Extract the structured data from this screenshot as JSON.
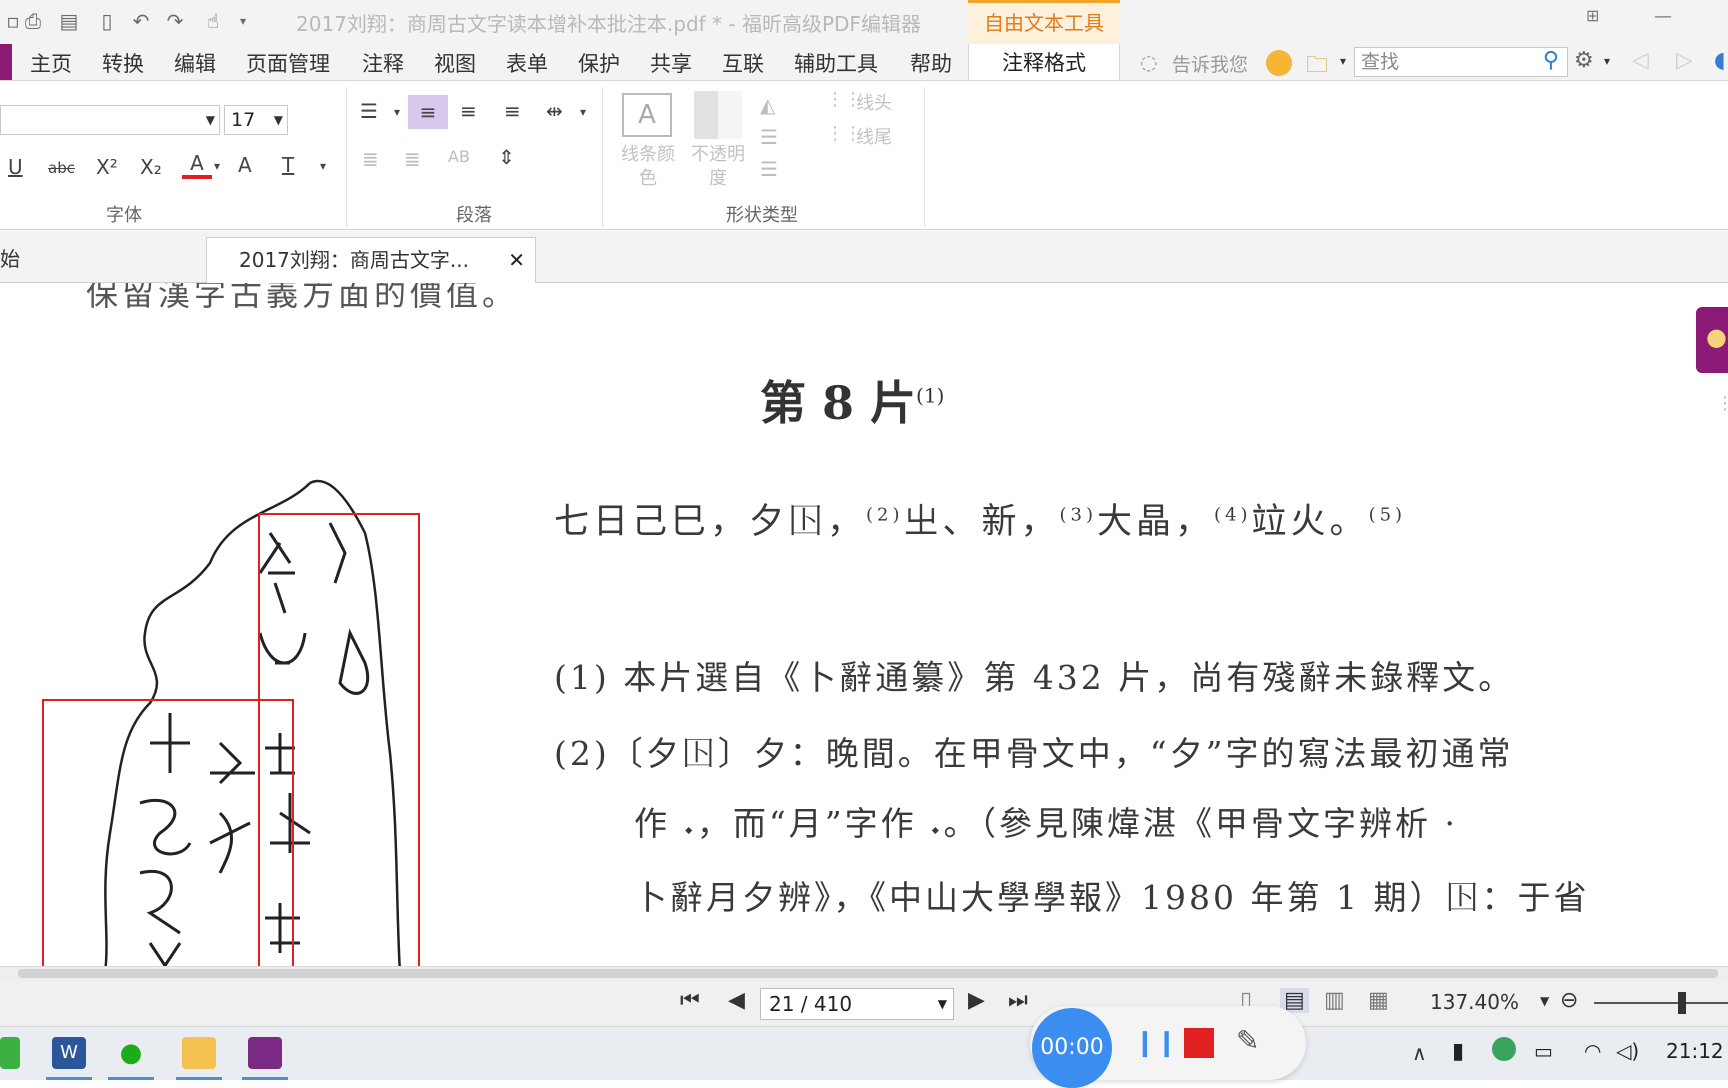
{
  "window": {
    "title": "2017刘翔：商周古文字读本增补本批注本.pdf * - 福昕高级PDF编辑器",
    "context_tab": "自由文本工具"
  },
  "menu": {
    "items": [
      "主页",
      "转换",
      "编辑",
      "页面管理",
      "注释",
      "视图",
      "表单",
      "保护",
      "共享",
      "互联",
      "辅助工具",
      "帮助"
    ],
    "active_tab": "注释格式",
    "tell_me": "告诉我您",
    "search_placeholder": "查找"
  },
  "ribbon": {
    "font_size": "17",
    "font_group_label": "字体",
    "paragraph_group_label": "段落",
    "shape_group_label": "形状类型",
    "line_color_label": "线条颜色",
    "opacity_label": "不透明度",
    "line_start_label": "线头",
    "line_end_label": "线尾",
    "font_buttons": [
      "U",
      "abc",
      "X²",
      "X₂",
      "A",
      "A",
      "T"
    ]
  },
  "tabs": {
    "start_tab": "始",
    "doc_tab": "2017刘翔：商周古文字...",
    "close_glyph": "✕"
  },
  "document": {
    "top_partial_line": "保留漢字古義方面的價值。",
    "heading": "第 8 片",
    "heading_note": "(1)",
    "main_line": {
      "s1": "七日己巳，夕𡆥，",
      "n2": "(2)",
      "s2": "㞢、新，",
      "n3": "(3)",
      "s3": "大晶，",
      "n4": "(4)",
      "s4": "竝火。",
      "n5": "(5)"
    },
    "notes": [
      "(1) 本片選自《卜辭通纂》第 432 片，尚有殘辭未錄釋文。",
      "(2)〔夕𡆥〕夕：晚間。在甲骨文中，“夕”字的寫法最初通常",
      "作 𝆺，而“月”字作 𝆺。（參見陳煒湛《甲骨文字辨析 ·",
      "卜辭月夕辨》，《中山大學學報》1980 年第 1 期）𡆥：于省"
    ]
  },
  "status": {
    "page": "21 / 410",
    "zoom": "137.40%"
  },
  "recorder": {
    "timer": "00:00"
  },
  "taskbar": {
    "clock": "21:12"
  },
  "colors": {
    "accent_purple": "#8b1a77",
    "context_orange": "#e07c1a",
    "annotation_red": "#e02020",
    "recorder_blue": "#3b8ef0"
  }
}
